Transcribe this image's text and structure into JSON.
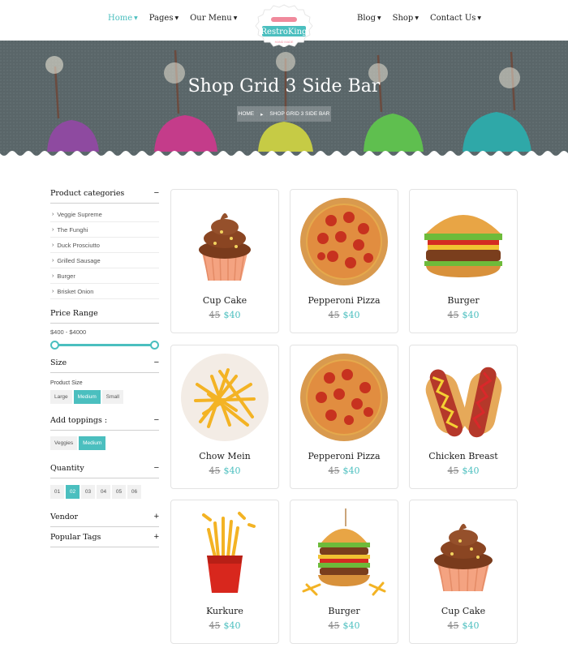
{
  "nav": {
    "left": [
      "Home",
      "Pages",
      "Our Menu"
    ],
    "right": [
      "Blog",
      "Shop",
      "Contact Us"
    ]
  },
  "logo": {
    "name": "RestroKing",
    "tagline": "HAND MADE"
  },
  "hero": {
    "title": "Shop Grid 3 Side Bar",
    "breadcrumb": [
      "HOME",
      "SHOP GRID 3 SIDE BAR"
    ]
  },
  "sidebar": {
    "categories_title": "Product categories",
    "categories": [
      "Veggie Supreme",
      "The Funghi",
      "Duck Prosciutto",
      "Grilled Sausage",
      "Burger",
      "Brisket Onion"
    ],
    "price_title": "Price Range",
    "price_range": "$400 - $4000",
    "price_slider": {
      "min_fraction": 0.0,
      "max_fraction": 1.0
    },
    "size_title": "Size",
    "size_sub": "Product Size",
    "sizes": [
      "Large",
      "Medium",
      "Small"
    ],
    "size_active": 1,
    "toppings_title": "Add toppings :",
    "toppings": [
      "Veggies",
      "Medium"
    ],
    "toppings_active": 1,
    "quantity_title": "Quantity",
    "quantities": [
      "01",
      "02",
      "03",
      "04",
      "05",
      "06"
    ],
    "quantity_active": 1,
    "vendor_title": "Vendor",
    "tags_title": "Popular Tags",
    "toggle_minus": "−",
    "toggle_plus": "+"
  },
  "products": [
    {
      "name": "Cup Cake",
      "old_price": "45",
      "price": "$40",
      "icon": "cupcake-icon"
    },
    {
      "name": "Pepperoni Pizza",
      "old_price": "45",
      "price": "$40",
      "icon": "pizza-icon"
    },
    {
      "name": "Burger",
      "old_price": "45",
      "price": "$40",
      "icon": "burger-icon"
    },
    {
      "name": "Chow Mein",
      "old_price": "45",
      "price": "$40",
      "icon": "fries-plate-icon"
    },
    {
      "name": "Pepperoni Pizza",
      "old_price": "45",
      "price": "$40",
      "icon": "pizza-icon"
    },
    {
      "name": "Chicken Breast",
      "old_price": "45",
      "price": "$40",
      "icon": "hotdog-icon"
    },
    {
      "name": "Kurkure",
      "old_price": "45",
      "price": "$40",
      "icon": "fries-box-icon"
    },
    {
      "name": "Burger",
      "old_price": "45",
      "price": "$40",
      "icon": "tall-burger-icon"
    },
    {
      "name": "Cup Cake",
      "old_price": "45",
      "price": "$40",
      "icon": "cupcake-icon"
    }
  ],
  "colors": {
    "accent": "#4bbfbf",
    "hero_bg": "#5d6a6d"
  }
}
